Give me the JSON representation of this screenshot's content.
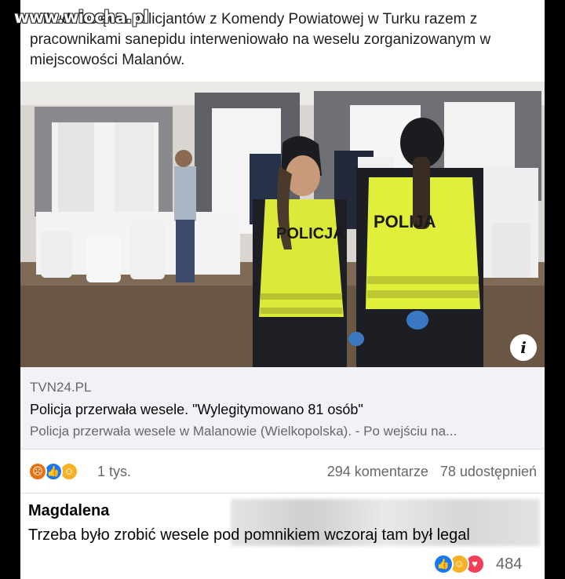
{
  "watermark": "www.wiocha.pl",
  "post": {
    "text": "Kilkudziesięciu policjantów z Komendy Powiatowej w Turku razem z pracownikami sanepidu interweniowało na weselu zorganizowanym w miejscowości Malanów."
  },
  "photo": {
    "vest_label_left": "POLICJA",
    "vest_label_right": "POLIJA",
    "info_icon": "i"
  },
  "link_preview": {
    "domain": "TVN24.PL",
    "title": "Policja przerwała wesele. \"Wylegitymowano 81 osób\"",
    "description": "Policja przerwała wesele w Malanowie (Wielkopolska). - Po wejściu na..."
  },
  "stats": {
    "reaction_icons": [
      "angry-icon",
      "like-icon",
      "haha-icon"
    ],
    "reaction_count": "1 tys.",
    "comments": "294 komentarze",
    "shares": "78 udostępnień"
  },
  "comment": {
    "author": "Magdalena",
    "text": "Trzeba było zrobić wesele pod pomnikiem wczoraj tam był legal",
    "reaction_icons": [
      "like-icon",
      "haha-icon",
      "love-icon"
    ],
    "reaction_count": "484"
  },
  "colors": {
    "link_blue": "#385898",
    "like": "#1877f2",
    "angry": "#e9710f",
    "haha": "#f7b125",
    "love": "#f33e58",
    "vest": "#e4f03a"
  }
}
